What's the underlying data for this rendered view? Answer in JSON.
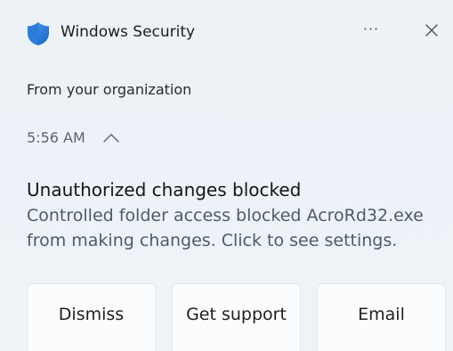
{
  "app": {
    "title": "Windows Security",
    "icon": "shield-icon",
    "accent_color": "#2f7bd9"
  },
  "header": {
    "more_label": "···",
    "close_icon": "close-icon"
  },
  "toast": {
    "source": "From your organization",
    "time": "5:56 AM",
    "title": "Unauthorized changes blocked",
    "body": "Controlled folder access blocked AcroRd32.exe from making changes. Click to see settings."
  },
  "buttons": {
    "dismiss": "Dismiss",
    "support": "Get support",
    "email": "Email"
  }
}
